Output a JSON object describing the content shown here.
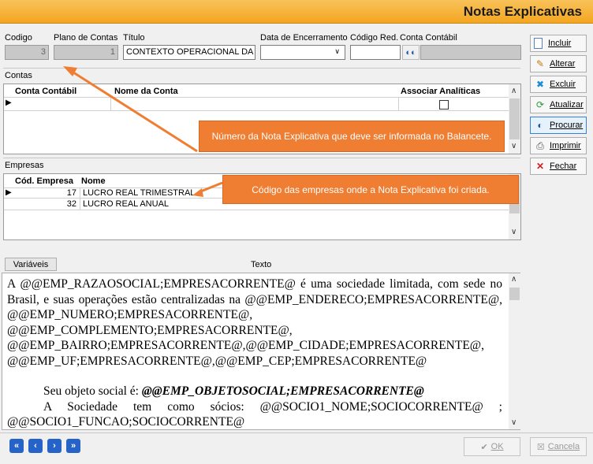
{
  "window": {
    "title": "Notas Explicativas"
  },
  "header": {
    "codigo_label": "Codigo",
    "codigo_value": "3",
    "plano_label": "Plano de Contas",
    "plano_value": "1",
    "titulo_label": "Título",
    "titulo_value": "CONTEXTO OPERACIONAL DA E",
    "data_label": "Data de Encerramento",
    "data_value": "",
    "codred_label": "Código Red.",
    "codred_value": "",
    "conta_label": "Conta Contábil"
  },
  "contas": {
    "section_label": "Contas",
    "columns": [
      "Conta Contábil",
      "Nome da Conta",
      "Associar Analíticas"
    ]
  },
  "empresas": {
    "section_label": "Empresas",
    "columns": [
      "Cód. Empresa",
      "Nome"
    ],
    "rows": [
      {
        "codigo": "17",
        "nome": "LUCRO REAL TRIMESTRAL"
      },
      {
        "codigo": "32",
        "nome": "LUCRO REAL ANUAL"
      }
    ]
  },
  "callouts": {
    "nota": "Número da Nota Explicativa que deve ser informada no Balancete.",
    "empresas": "Código das empresas onde a Nota Explicativa foi criada."
  },
  "texto": {
    "variaveis_button": "Variáveis",
    "label": "Texto",
    "paragraph1": "A @@EMP_RAZAOSOCIAL;EMPRESACORRENTE@ é uma sociedade limitada, com sede no Brasil, e suas operações estão centralizadas na @@EMP_ENDERECO;EMPRESACORRENTE@, @@EMP_NUMERO;EMPRESACORRENTE@, @@EMP_COMPLEMENTO;EMPRESACORRENTE@, @@EMP_BAIRRO;EMPRESACORRENTE@,@@EMP_CIDADE;EMPRESACORRENTE@, @@EMP_UF;EMPRESACORRENTE@,@@EMP_CEP;EMPRESACORRENTE@",
    "line_objeto_prefix": "Seu objeto social é: ",
    "line_objeto_var": "@@EMP_OBJETOSOCIAL;EMPRESACORRENTE@",
    "line_socios": "A Sociedade tem como sócios: @@SOCIO1_NOME;SOCIOCORRENTE@ ; @@SOCIO1_FUNCAO;SOCIOCORRENTE@"
  },
  "sidebar": {
    "incluir": "Incluir",
    "alterar": "Alterar",
    "excluir": "Excluir",
    "atualizar": "Atualizar",
    "procurar": "Procurar",
    "imprimir": "Imprimir",
    "fechar": "Fechar"
  },
  "footer": {
    "ok": "OK",
    "cancela": "Cancela",
    "nav": [
      "first",
      "prev",
      "next",
      "last"
    ]
  },
  "colors": {
    "titlebar": "#f3a620",
    "callout": "#ef7d32",
    "nav": "#2563c9"
  }
}
